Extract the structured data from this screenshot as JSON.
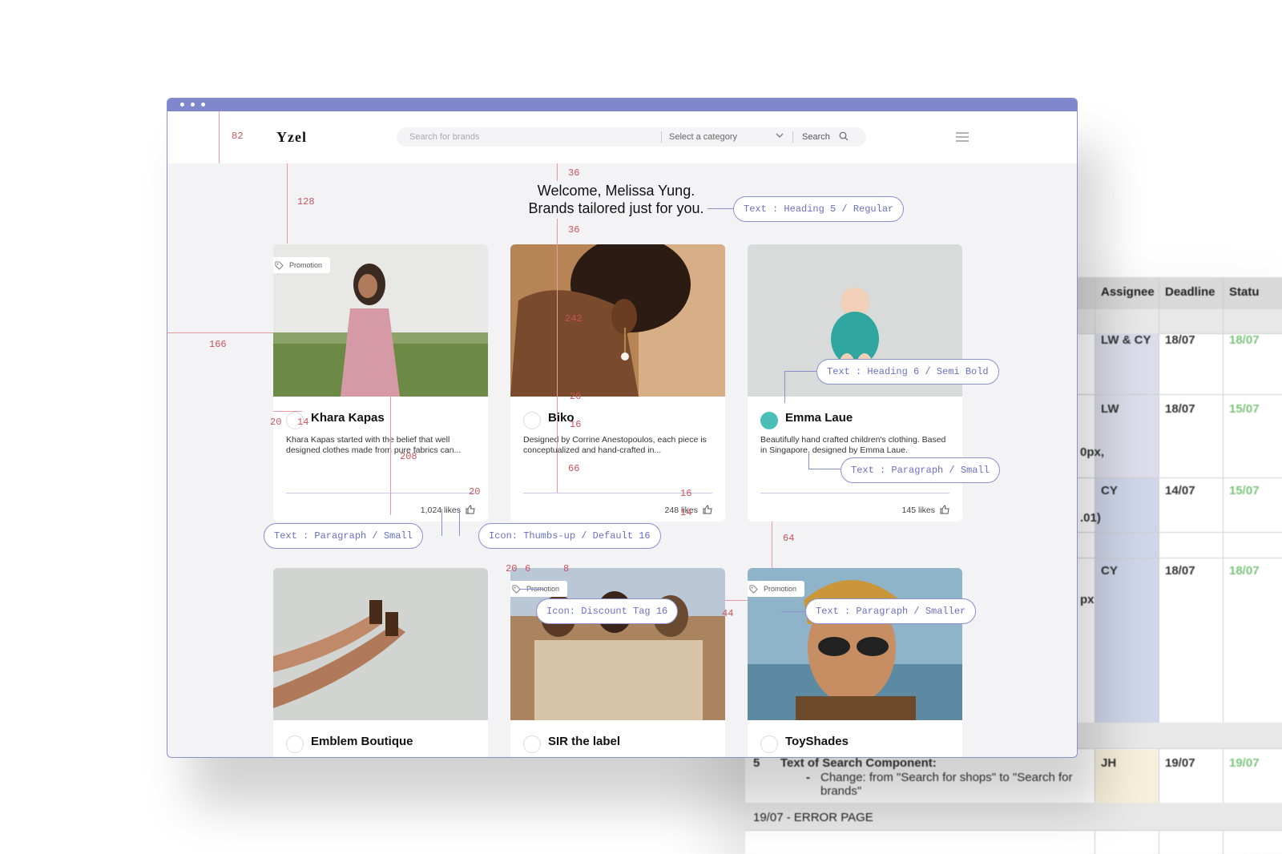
{
  "spreadsheet": {
    "headers": [
      "Assignee",
      "Deadline",
      "Statu"
    ],
    "rows": [
      {
        "assignee": "LW & CY",
        "deadline": "18/07",
        "status": "18/07"
      },
      {
        "assignee": "LW",
        "deadline": "18/07",
        "status": "15/07"
      },
      {
        "assignee": "CY",
        "deadline": "14/07",
        "status": "15/07"
      },
      {
        "assignee": "CY",
        "deadline": "18/07",
        "status": "18/07"
      }
    ],
    "side_notes": [
      "0px,",
      ".01)",
      "px"
    ],
    "task_row": {
      "number": "5",
      "title": "Text of Search Component:",
      "bullet": "-",
      "detail": "Change: from \"Search for shops\" to \"Search for brands\"",
      "assignee": "JH",
      "deadline": "19/07",
      "status": "19/07"
    },
    "section_label": "19/07 - ERROR PAGE"
  },
  "app": {
    "logo": "Yzel",
    "search": {
      "placeholder": "Search for brands",
      "category_label": "Select a category",
      "button_label": "Search"
    },
    "welcome_line1": "Welcome, Melissa Yung.",
    "welcome_line2": "Brands tailored just for you.",
    "promo_label": "Promotion",
    "cards": [
      {
        "name": "Khara Kapas",
        "desc": "Khara Kapas started with the belief that well designed clothes made from pure fabrics can...",
        "likes": "1,024 likes",
        "promo": true
      },
      {
        "name": "Biko",
        "desc": "Designed by Corrine Anestopoulos, each piece is conceptualized and hand-crafted in...",
        "likes": "248 likes",
        "promo": false
      },
      {
        "name": "Emma Laue",
        "desc": "Beautifully hand crafted children's clothing. Based in Singapore, designed by Emma Laue.",
        "likes": "145 likes",
        "promo": false
      },
      {
        "name": "Emblem Boutique",
        "promo": false
      },
      {
        "name": "SIR the label",
        "promo": true
      },
      {
        "name": "ToyShades",
        "promo": true
      }
    ]
  },
  "annotations": {
    "spacing": [
      "82",
      "128",
      "166",
      "36",
      "36",
      "242",
      "20",
      "14",
      "20",
      "16",
      "208",
      "66",
      "20",
      "16",
      "14",
      "64",
      "20",
      "6",
      "8",
      "44"
    ],
    "labels": [
      "Text : Heading 5 / Regular",
      "Text : Heading 6 / Semi Bold",
      "Text : Paragraph / Small",
      "Text : Paragraph / Small",
      "Icon: Thumbs-up / Default 16",
      "Icon: Discount Tag 16",
      "Text : Paragraph / Smaller"
    ]
  },
  "colors": {
    "accent": "#8087cc",
    "annotation_red": "#c8545c",
    "annotation_blue": "#6a70c4",
    "background": "#f3f3f5"
  }
}
